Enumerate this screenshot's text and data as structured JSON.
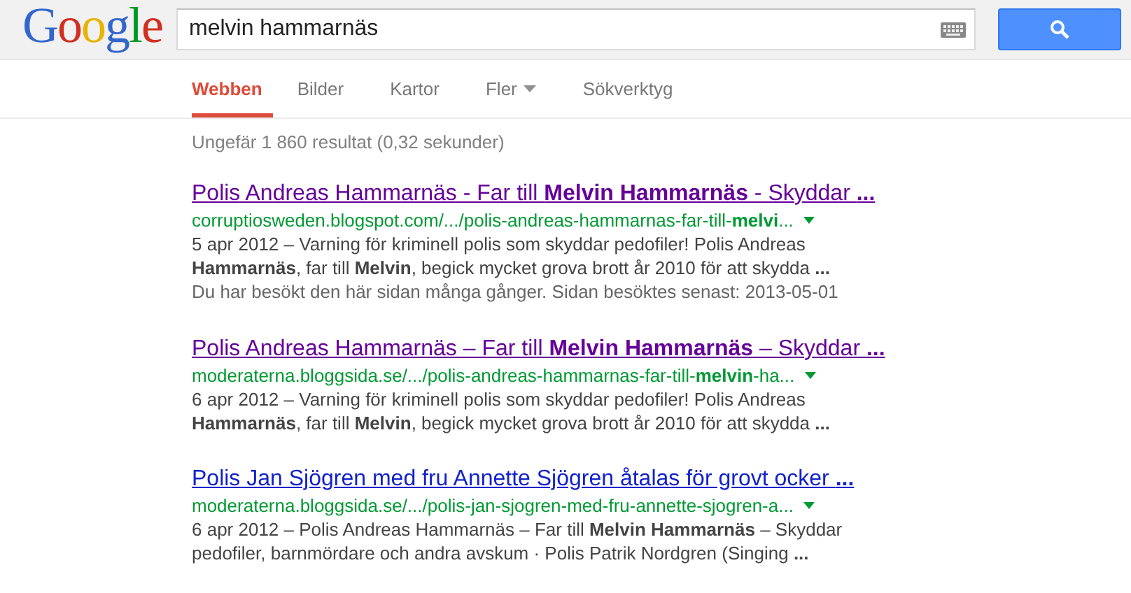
{
  "header": {
    "logo": "Google",
    "search": {
      "value": "melvin hammarnäs"
    }
  },
  "tabs": [
    {
      "label": "Webben",
      "selected": true,
      "dropdown": false
    },
    {
      "label": "Bilder",
      "selected": false,
      "dropdown": false
    },
    {
      "label": "Kartor",
      "selected": false,
      "dropdown": false
    },
    {
      "label": "Fler",
      "selected": false,
      "dropdown": true
    },
    {
      "label": "Sökverktyg",
      "selected": false,
      "dropdown": false
    }
  ],
  "result_stats": "Ungefär 1 860 resultat (0,32 sekunder)",
  "results": [
    {
      "title": "Polis Andreas Hammarnäs - Far till **Melvin Hammarnäs** - Skyddar **...**",
      "visited": true,
      "url": "corruptiosweden.blogspot.com/.../polis-andreas-hammarnas-far-till-**melvi**...",
      "snippet": "5 apr 2012 – Varning för kriminell polis som skyddar pedofiler! Polis Andreas **Hammarnäs**, far till **Melvin**, begick mycket grova brott år 2010 för att skydda **...**",
      "visit_note": "Du har besökt den här sidan många gånger. Sidan besöktes senast: 2013-05-01"
    },
    {
      "title": "Polis Andreas Hammarnäs – Far till **Melvin Hammarnäs** – Skyddar **...**",
      "visited": true,
      "url": "moderaterna.bloggsida.se/.../polis-andreas-hammarnas-far-till-**melvin**-ha...",
      "snippet": "6 apr 2012 – Varning för kriminell polis som skyddar pedofiler! Polis Andreas **Hammarnäs**, far till **Melvin**, begick mycket grova brott år 2010 för att skydda **...**"
    },
    {
      "title": "Polis Jan Sjögren med fru Annette Sjögren åtalas för grovt ocker **...**",
      "visited": false,
      "url": "moderaterna.bloggsida.se/.../polis-jan-sjogren-med-fru-annette-sjogren-a...",
      "snippet": "6 apr 2012 – Polis Andreas Hammarnäs – Far till **Melvin Hammarnäs** – Skyddar pedofiler, barnmördare och andra avskum · Polis Patrik Nordgren (Singing **...**"
    }
  ]
}
